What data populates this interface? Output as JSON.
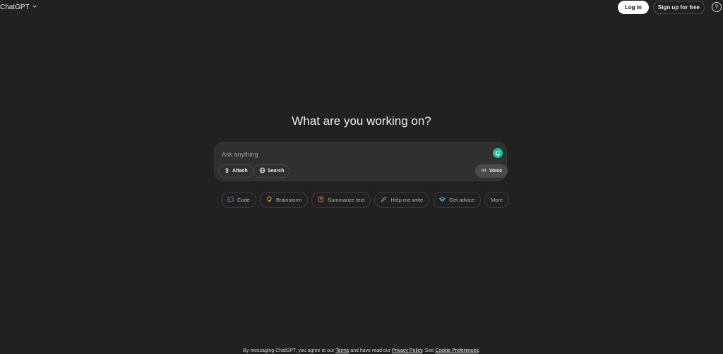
{
  "header": {
    "model_name": "ChatGPT",
    "login_label": "Log in",
    "signup_label": "Sign up for free",
    "help_label": "?"
  },
  "main": {
    "headline": "What are you working on?"
  },
  "composer": {
    "placeholder": "Ask anything",
    "attach_label": "Attach",
    "search_label": "Search",
    "voice_label": "Voice"
  },
  "suggestions": [
    {
      "label": "Code",
      "icon": "code-icon",
      "color": "#6e78ff"
    },
    {
      "label": "Brainstorm",
      "icon": "lightbulb-icon",
      "color": "#e2c541"
    },
    {
      "label": "Summarize text",
      "icon": "document-icon",
      "color": "#ea8444"
    },
    {
      "label": "Help me write",
      "icon": "pen-icon",
      "color": "#cb8bd0"
    },
    {
      "label": "Get advice",
      "icon": "graduation-cap-icon",
      "color": "#76d0eb"
    },
    {
      "label": "More",
      "icon": "",
      "color": "#b4b4b4"
    }
  ],
  "footer": {
    "prefix": "By messaging ChatGPT, you agree to our ",
    "terms": "Terms",
    "middle": " and have read our ",
    "privacy": "Privacy Policy",
    "sep": ". See ",
    "cookie": "Cookie Preferences",
    "suffix": "."
  }
}
